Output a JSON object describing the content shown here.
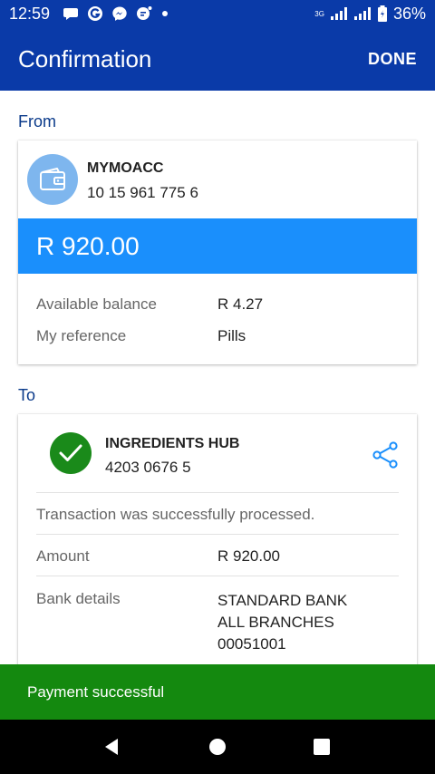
{
  "status_bar": {
    "time": "12:59",
    "network_label": "3G",
    "battery": "36%",
    "icons": [
      "chat-bubble-icon",
      "grammarly-icon",
      "messenger-icon",
      "chat-head-icon",
      "dot-icon"
    ]
  },
  "app_bar": {
    "title": "Confirmation",
    "done_label": "DONE"
  },
  "from": {
    "section_label": "From",
    "account_name": "MYMOACC",
    "account_number": "10 15 961 775 6",
    "amount": "R 920.00",
    "rows": [
      {
        "label": "Available balance",
        "value": "R 4.27"
      },
      {
        "label": "My reference",
        "value": "Pills"
      }
    ]
  },
  "to": {
    "section_label": "To",
    "recipient_name": "INGREDIENTS HUB",
    "recipient_number": "4203 0676 5",
    "status_message": "Transaction was successfully processed.",
    "amount_label": "Amount",
    "amount_value": "R 920.00",
    "bank_label": "Bank details",
    "bank_lines": [
      "STANDARD BANK",
      "ALL BRANCHES",
      "00051001"
    ]
  },
  "snackbar": {
    "message": "Payment successful"
  },
  "colors": {
    "app_bar": "#0a3aa8",
    "amount_bar": "#1a8ffc",
    "success": "#14890f",
    "wallet_circle": "#7eb6ee"
  }
}
